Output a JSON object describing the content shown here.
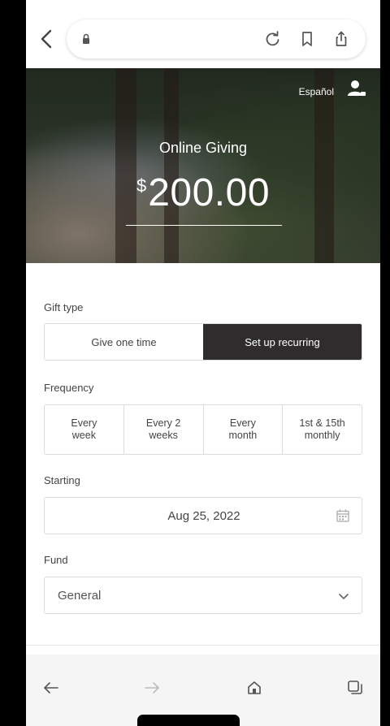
{
  "browser": {
    "icons": [
      "back-chevron-icon",
      "lock-icon",
      "reload-icon",
      "bookmark-icon",
      "share-icon"
    ]
  },
  "hero": {
    "language_link": "Español",
    "title": "Online Giving",
    "currency_symbol": "$",
    "amount": "200.00"
  },
  "gift_type": {
    "label": "Gift type",
    "options": [
      "Give one time",
      "Set up recurring"
    ],
    "selected": "Set up recurring"
  },
  "frequency": {
    "label": "Frequency",
    "options": [
      {
        "line1": "Every",
        "line2": "week"
      },
      {
        "line1": "Every 2",
        "line2": "weeks"
      },
      {
        "line1": "Every",
        "line2": "month"
      },
      {
        "line1": "1st & 15th",
        "line2": "monthly"
      }
    ]
  },
  "starting": {
    "label": "Starting",
    "value": "Aug 25, 2022"
  },
  "fund": {
    "label": "Fund",
    "value": "General"
  },
  "bottom_bar": {
    "icons": [
      "back-arrow-icon",
      "forward-arrow-icon",
      "home-icon",
      "tabs-icon"
    ]
  },
  "colors": {
    "active_segment": "#2f2c2d",
    "border": "#dcdcdc"
  }
}
